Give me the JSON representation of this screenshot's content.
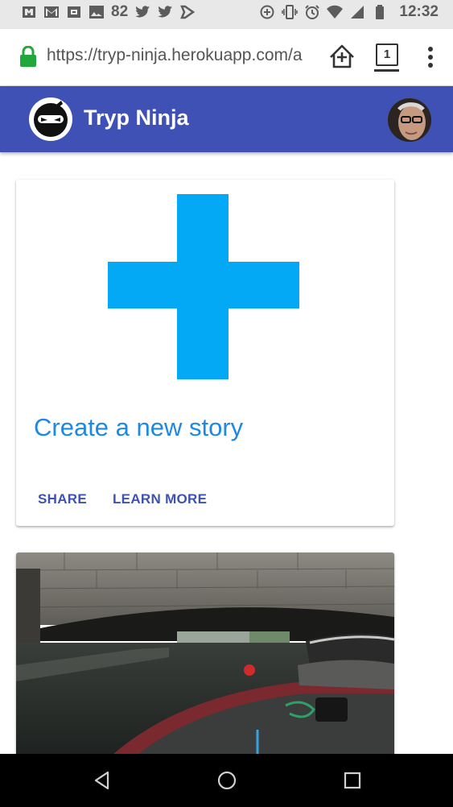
{
  "status_bar": {
    "notification_count": "82",
    "time": "12:32",
    "left_icons": [
      "amazon-icon",
      "gmail-icon",
      "amazon-icon",
      "image-icon",
      "twitter-icon",
      "twitter-icon",
      "feedly-icon"
    ],
    "right_icons": [
      "data-saver-icon",
      "vibrate-icon",
      "alarm-icon",
      "wifi-icon",
      "signal-icon",
      "battery-icon"
    ]
  },
  "browser": {
    "url": "https://tryp-ninja.herokuapp.com/a",
    "tab_count": "1",
    "secure_color": "#22a83a"
  },
  "app_bar": {
    "title": "Tryp Ninja",
    "color": "#3f51b5"
  },
  "create_card": {
    "title": "Create a new story",
    "actions": [
      "SHARE",
      "LEARN MORE"
    ],
    "plus_color": "#03a9f4",
    "title_color": "#1e88e5"
  },
  "photo_card": {
    "image_subject": "boat under stone bridge on canal"
  },
  "nav_bar": {
    "buttons": [
      "back-icon",
      "home-icon",
      "recents-icon"
    ]
  }
}
